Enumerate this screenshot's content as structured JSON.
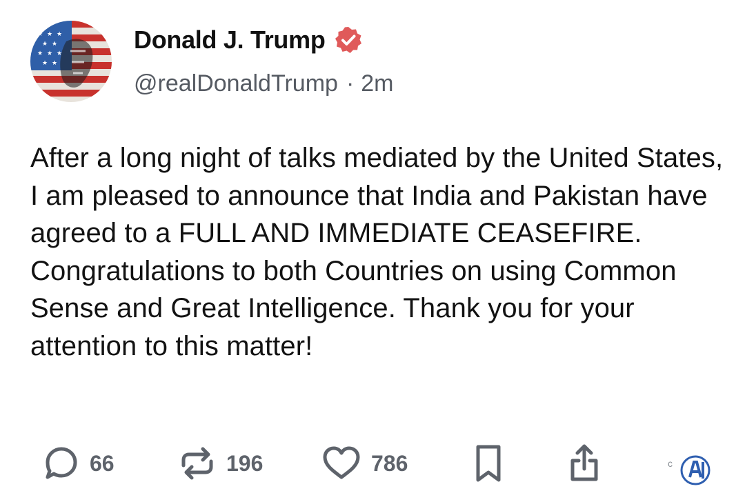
{
  "author": {
    "display_name": "Donald J. Trump",
    "handle": "@realDonaldTrump",
    "separator": "·",
    "timestamp": "2m",
    "verified": true,
    "avatar_icon": "flag-portrait-avatar"
  },
  "post": {
    "text": "After a long night of talks mediated by the United States, I am pleased to announce that India and Pakistan have agreed to a FULL AND IMMEDIATE CEASEFIRE. Congratulations to both Countries on using Common Sense and Great Intelligence. Thank you for your attention to this matter!"
  },
  "actions": {
    "reply": {
      "icon": "reply-bubble-icon",
      "count": "66"
    },
    "repost": {
      "icon": "repost-icon",
      "count": "196"
    },
    "like": {
      "icon": "heart-icon",
      "count": "786"
    },
    "bookmark": {
      "icon": "bookmark-icon"
    },
    "share": {
      "icon": "share-icon"
    }
  },
  "watermark": {
    "label": "c",
    "icon": "watermark-logo"
  },
  "colors": {
    "verified_badge": "#e05a5a",
    "text": "#121212",
    "muted": "#5e636b"
  }
}
